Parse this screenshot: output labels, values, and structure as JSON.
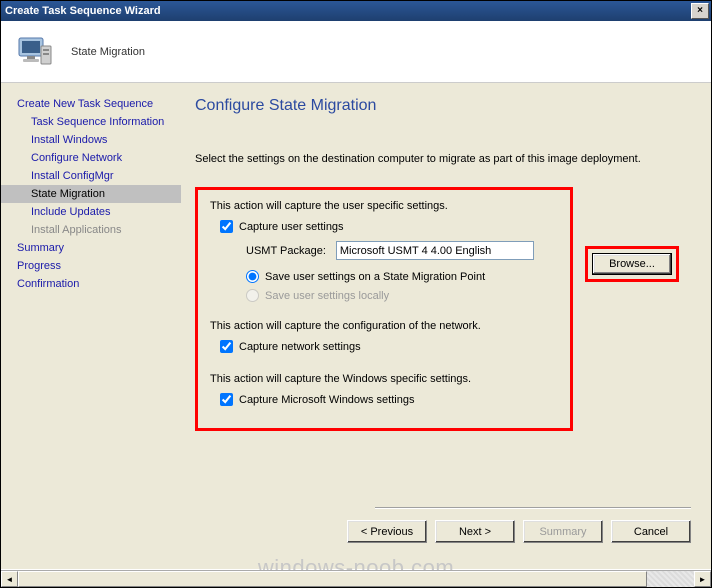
{
  "window": {
    "title": "Create Task Sequence Wizard",
    "close_label": "×"
  },
  "header": {
    "step_name": "State Migration"
  },
  "sidebar": {
    "items": [
      {
        "label": "Create New Task Sequence",
        "sub": false,
        "active": false
      },
      {
        "label": "Task Sequence Information",
        "sub": true,
        "active": false
      },
      {
        "label": "Install Windows",
        "sub": true,
        "active": false
      },
      {
        "label": "Configure Network",
        "sub": true,
        "active": false
      },
      {
        "label": "Install ConfigMgr",
        "sub": true,
        "active": false
      },
      {
        "label": "State Migration",
        "sub": true,
        "active": true
      },
      {
        "label": "Include Updates",
        "sub": true,
        "active": false
      },
      {
        "label": "Install Applications",
        "sub": true,
        "active": false
      },
      {
        "label": "Summary",
        "sub": false,
        "active": false
      },
      {
        "label": "Progress",
        "sub": false,
        "active": false
      },
      {
        "label": "Confirmation",
        "sub": false,
        "active": false
      }
    ]
  },
  "main": {
    "page_title": "Configure State Migration",
    "instruction": "Select the settings on the destination computer to migrate as part of this image deployment.",
    "sec1": "This action will capture the user specific settings.",
    "chk_user": "Capture user settings",
    "chk_user_checked": true,
    "usmt_label": "USMT Package:",
    "usmt_value": "Microsoft USMT 4 4.00 English",
    "browse_label": "Browse...",
    "radio_smp": "Save user settings on a State Migration Point",
    "radio_local": "Save user settings locally",
    "radio_selected": "smp",
    "sec2": "This action will capture the configuration of the network.",
    "chk_net": "Capture network settings",
    "chk_net_checked": true,
    "sec3": "This action will capture the Windows specific settings.",
    "chk_win": "Capture Microsoft Windows settings",
    "chk_win_checked": true
  },
  "footer": {
    "previous": "< Previous",
    "next": "Next >",
    "summary": "Summary",
    "cancel": "Cancel"
  },
  "watermark": "windows-noob.com"
}
